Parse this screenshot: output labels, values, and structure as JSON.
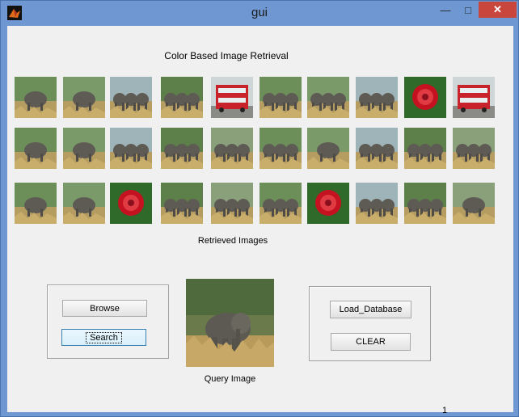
{
  "window": {
    "title": "gui"
  },
  "header": {
    "title": "Color Based Image Retrieval"
  },
  "results": {
    "label": "Retrieved Images",
    "rows": [
      [
        "elephant",
        "elephant",
        "elephants",
        "elephants",
        "bus",
        "elephants",
        "elephants",
        "elephants",
        "rose",
        "bus"
      ],
      [
        "elephant",
        "elephant",
        "elephants",
        "elephants",
        "elephants",
        "elephants",
        "elephant",
        "elephants",
        "elephants",
        "elephants"
      ],
      [
        "elephant",
        "elephant",
        "rose",
        "elephants",
        "elephants",
        "elephants",
        "rose",
        "elephants",
        "elephants",
        "elephant"
      ]
    ]
  },
  "left_panel": {
    "browse_label": "Browse",
    "search_label": "Search"
  },
  "query": {
    "label": "Query Image"
  },
  "right_panel": {
    "load_label": "Load_Database",
    "clear_label": "CLEAR"
  },
  "footer": {
    "corner_text": "1"
  }
}
